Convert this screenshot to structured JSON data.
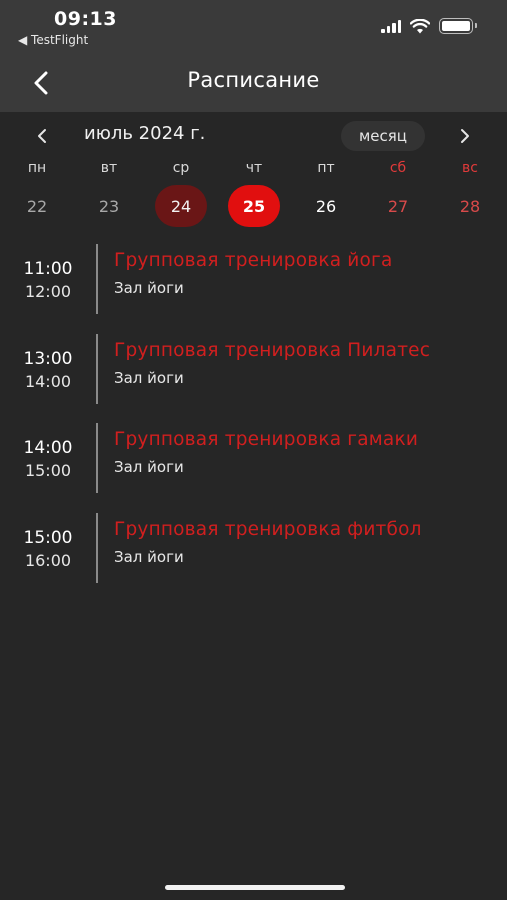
{
  "status_bar": {
    "time": "09:13",
    "back_app": "◀ TestFlight",
    "signal_bars": 4,
    "battery_level": 1.0
  },
  "nav": {
    "title": "Расписание",
    "back_icon": "chevron-left-icon"
  },
  "calendar": {
    "month_label": "июль 2024 г.",
    "view_toggle": "месяц",
    "weekdays": [
      {
        "label": "пн",
        "weekend": false
      },
      {
        "label": "вт",
        "weekend": false
      },
      {
        "label": "ср",
        "weekend": false
      },
      {
        "label": "чт",
        "weekend": false
      },
      {
        "label": "пт",
        "weekend": false
      },
      {
        "label": "сб",
        "weekend": true
      },
      {
        "label": "вс",
        "weekend": true
      }
    ],
    "dates": [
      {
        "label": "22",
        "state": "past"
      },
      {
        "label": "23",
        "state": "past"
      },
      {
        "label": "24",
        "state": "today"
      },
      {
        "label": "25",
        "state": "selected"
      },
      {
        "label": "26",
        "state": "future"
      },
      {
        "label": "27",
        "state": "weekend"
      },
      {
        "label": "28",
        "state": "weekend"
      }
    ]
  },
  "events": [
    {
      "start": "11:00",
      "end": "12:00",
      "title": "Групповая тренировка йога",
      "room": "Зал йоги"
    },
    {
      "start": "13:00",
      "end": "14:00",
      "title": "Групповая тренировка Пилатес",
      "room": "Зал йоги"
    },
    {
      "start": "14:00",
      "end": "15:00",
      "title": "Групповая тренировка гамаки",
      "room": "Зал йоги"
    },
    {
      "start": "15:00",
      "end": "16:00",
      "title": "Групповая тренировка фитбол",
      "room": "Зал йоги"
    }
  ],
  "colors": {
    "background": "#262626",
    "header": "#3a3a3a",
    "accent": "#e10f0f",
    "today_bg": "#6a1616",
    "event_title": "#d11f1f"
  }
}
